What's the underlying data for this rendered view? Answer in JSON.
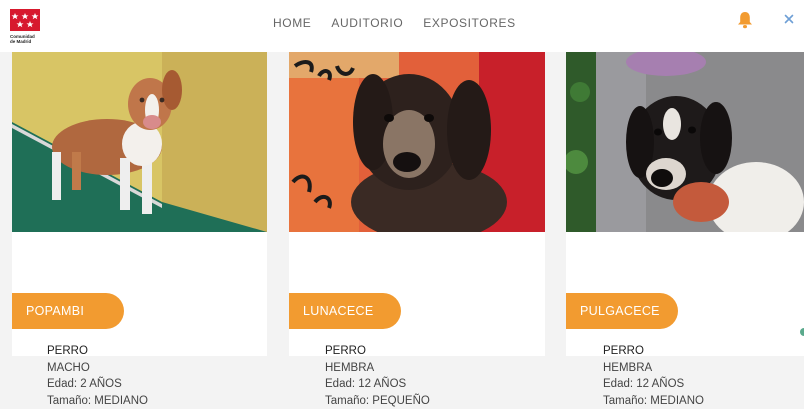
{
  "header": {
    "logo_lines": [
      "Comunidad",
      "de Madrid"
    ],
    "nav": [
      "HOME",
      "AUDITORIO",
      "EXPOSITORES"
    ],
    "accent_color": "#f29b30"
  },
  "icons": {
    "logo": "comunidad-de-madrid-flag",
    "notifications": "bell-icon",
    "close": "close-icon"
  },
  "cards": [
    {
      "name": "POPAMBI",
      "species": "PERRO",
      "sex": "MACHO",
      "age": "Edad: 2 AÑOS",
      "size": "Tamaño: MEDIANO"
    },
    {
      "name": "LUNACECE",
      "species": "PERRO",
      "sex": "HEMBRA",
      "age": "Edad: 12 AÑOS",
      "size": "Tamaño: PEQUEÑO"
    },
    {
      "name": "PULGACECE",
      "species": "PERRO",
      "sex": "HEMBRA",
      "age": "Edad: 12 AÑOS",
      "size": "Tamaño: MEDIANO"
    }
  ]
}
